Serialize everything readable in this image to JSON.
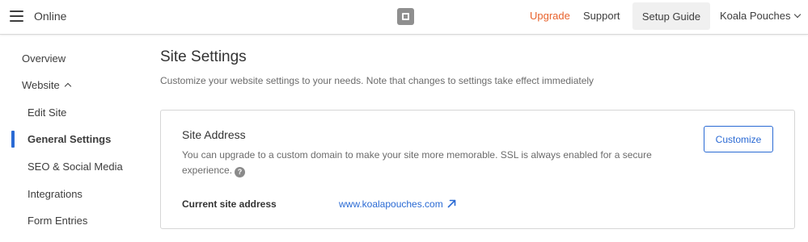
{
  "header": {
    "app_title": "Online",
    "upgrade_label": "Upgrade",
    "support_label": "Support",
    "setup_guide_label": "Setup Guide",
    "account_name": "Koala Pouches",
    "accent_color": "#e8622c"
  },
  "sidebar": {
    "items": [
      {
        "label": "Overview"
      },
      {
        "label": "Website"
      },
      {
        "label": "Edit Site"
      },
      {
        "label": "General Settings",
        "active": true
      },
      {
        "label": "SEO & Social Media"
      },
      {
        "label": "Integrations"
      },
      {
        "label": "Form Entries"
      }
    ],
    "active_color": "#2a6ad4"
  },
  "main": {
    "title": "Site Settings",
    "description": "Customize your website settings to your needs. Note that changes to settings take effect immediately",
    "site_address_card": {
      "title": "Site Address",
      "description": "You can upgrade to a custom domain to make your site more memorable. SSL is always enabled for a secure experience.",
      "help_icon_glyph": "?",
      "customize_label": "Customize",
      "current_address_label": "Current site address",
      "current_address_value": "www.koalapouches.com"
    }
  },
  "icons": {
    "menu": "hamburger-icon",
    "logo": "square-logo",
    "account_dropdown": "chevron-down-icon",
    "website_collapse": "chevron-up-icon",
    "help": "question-circle-icon",
    "external_link": "arrow-up-right-icon"
  }
}
